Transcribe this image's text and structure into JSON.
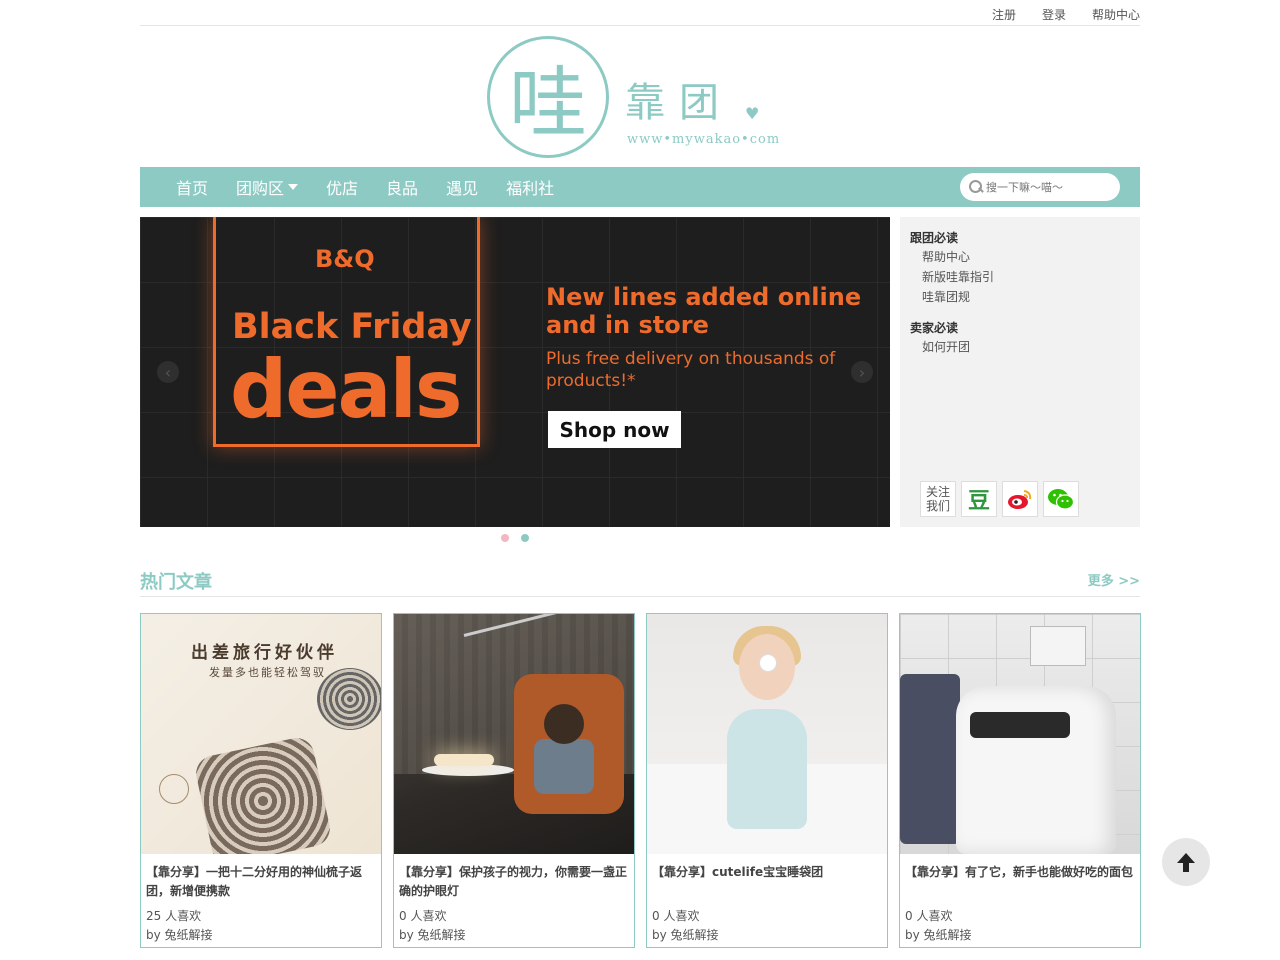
{
  "toplinks": {
    "register": "注册",
    "login": "登录",
    "help": "帮助中心"
  },
  "logo": {
    "char": "哇",
    "text": "靠团",
    "url": "www•mywakao•com"
  },
  "nav": {
    "items": [
      "首页",
      "团购区",
      "优店",
      "良品",
      "遇见",
      "福利社"
    ],
    "search_placeholder": "搜一下嘛～喵～"
  },
  "banner": {
    "brand": "B&Q",
    "headline1": "Black Friday",
    "headline2": "deals",
    "sub1": "New lines added online and in store",
    "sub2": "Plus free delivery on thousands of products!*",
    "cta": "Shop now"
  },
  "sidebar": {
    "sec1_title": "跟团必读",
    "sec1_links": [
      "帮助中心",
      "新版哇靠指引",
      "哇靠团规"
    ],
    "sec2_title": "卖家必读",
    "sec2_links": [
      "如何开团"
    ],
    "follow_text": "关注我们",
    "douban": "豆"
  },
  "hot": {
    "title": "热门文章",
    "more": "更多 >>"
  },
  "cards": [
    {
      "title": "【靠分享】一把十二分好用的神仙梳子返团，新增便携款",
      "likes": "25 人喜欢",
      "by": "by 兔纸解接",
      "img_t1": "出差旅行好伙伴",
      "img_t2": "发量多也能轻松驾驭"
    },
    {
      "title": "【靠分享】保护孩子的视力，你需要一盏正确的护眼灯",
      "likes": "0 人喜欢",
      "by": "by 兔纸解接"
    },
    {
      "title": "【靠分享】cutelife宝宝睡袋团",
      "likes": "0 人喜欢",
      "by": "by 兔纸解接"
    },
    {
      "title": "【靠分享】有了它，新手也能做好吃的面包",
      "likes": "0 人喜欢",
      "by": "by 兔纸解接"
    }
  ],
  "colors": {
    "accent": "#8dcac4",
    "banner_orange": "#ef6b2c"
  }
}
